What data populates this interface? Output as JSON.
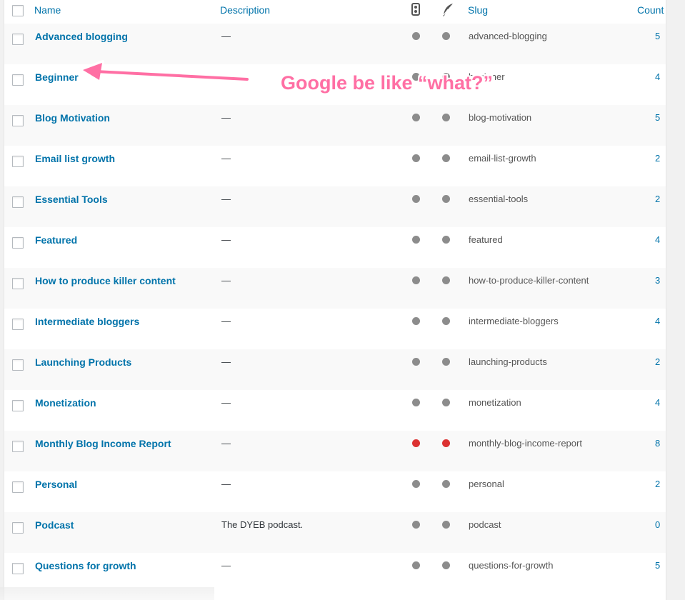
{
  "header": {
    "name": "Name",
    "description": "Description",
    "slug": "Slug",
    "count": "Count",
    "icon1": "seo-traffic-light-icon",
    "icon2": "feather-icon"
  },
  "rows": [
    {
      "name": "Advanced blogging",
      "desc": "—",
      "slug": "advanced-blogging",
      "count": "5",
      "dot_color": "#8c8c8c"
    },
    {
      "name": "Beginner",
      "desc": "—",
      "slug": "beginner",
      "count": "4",
      "dot_color": "#8c8c8c"
    },
    {
      "name": "Blog Motivation",
      "desc": "—",
      "slug": "blog-motivation",
      "count": "5",
      "dot_color": "#8c8c8c"
    },
    {
      "name": "Email list growth",
      "desc": "—",
      "slug": "email-list-growth",
      "count": "2",
      "dot_color": "#8c8c8c"
    },
    {
      "name": "Essential Tools",
      "desc": "—",
      "slug": "essential-tools",
      "count": "2",
      "dot_color": "#8c8c8c"
    },
    {
      "name": "Featured",
      "desc": "—",
      "slug": "featured",
      "count": "4",
      "dot_color": "#8c8c8c"
    },
    {
      "name": "How to produce killer content",
      "desc": "—",
      "slug": "how-to-produce-killer-content",
      "count": "3",
      "dot_color": "#8c8c8c"
    },
    {
      "name": "Intermediate bloggers",
      "desc": "—",
      "slug": "intermediate-bloggers",
      "count": "4",
      "dot_color": "#8c8c8c"
    },
    {
      "name": "Launching Products",
      "desc": "—",
      "slug": "launching-products",
      "count": "2",
      "dot_color": "#8c8c8c"
    },
    {
      "name": "Monetization",
      "desc": "—",
      "slug": "monetization",
      "count": "4",
      "dot_color": "#8c8c8c"
    },
    {
      "name": "Monthly Blog Income Report",
      "desc": "—",
      "slug": "monthly-blog-income-report",
      "count": "8",
      "dot_color": "#dc3232"
    },
    {
      "name": "Personal",
      "desc": "—",
      "slug": "personal",
      "count": "2",
      "dot_color": "#8c8c8c"
    },
    {
      "name": "Podcast",
      "desc": "The DYEB podcast.",
      "slug": "podcast",
      "count": "0",
      "dot_color": "#8c8c8c"
    },
    {
      "name": "Questions for growth",
      "desc": "—",
      "slug": "questions-for-growth",
      "count": "5",
      "dot_color": "#8c8c8c"
    }
  ],
  "annotation": {
    "text": "Google be like “what?”",
    "color": "#ff6fa4"
  }
}
